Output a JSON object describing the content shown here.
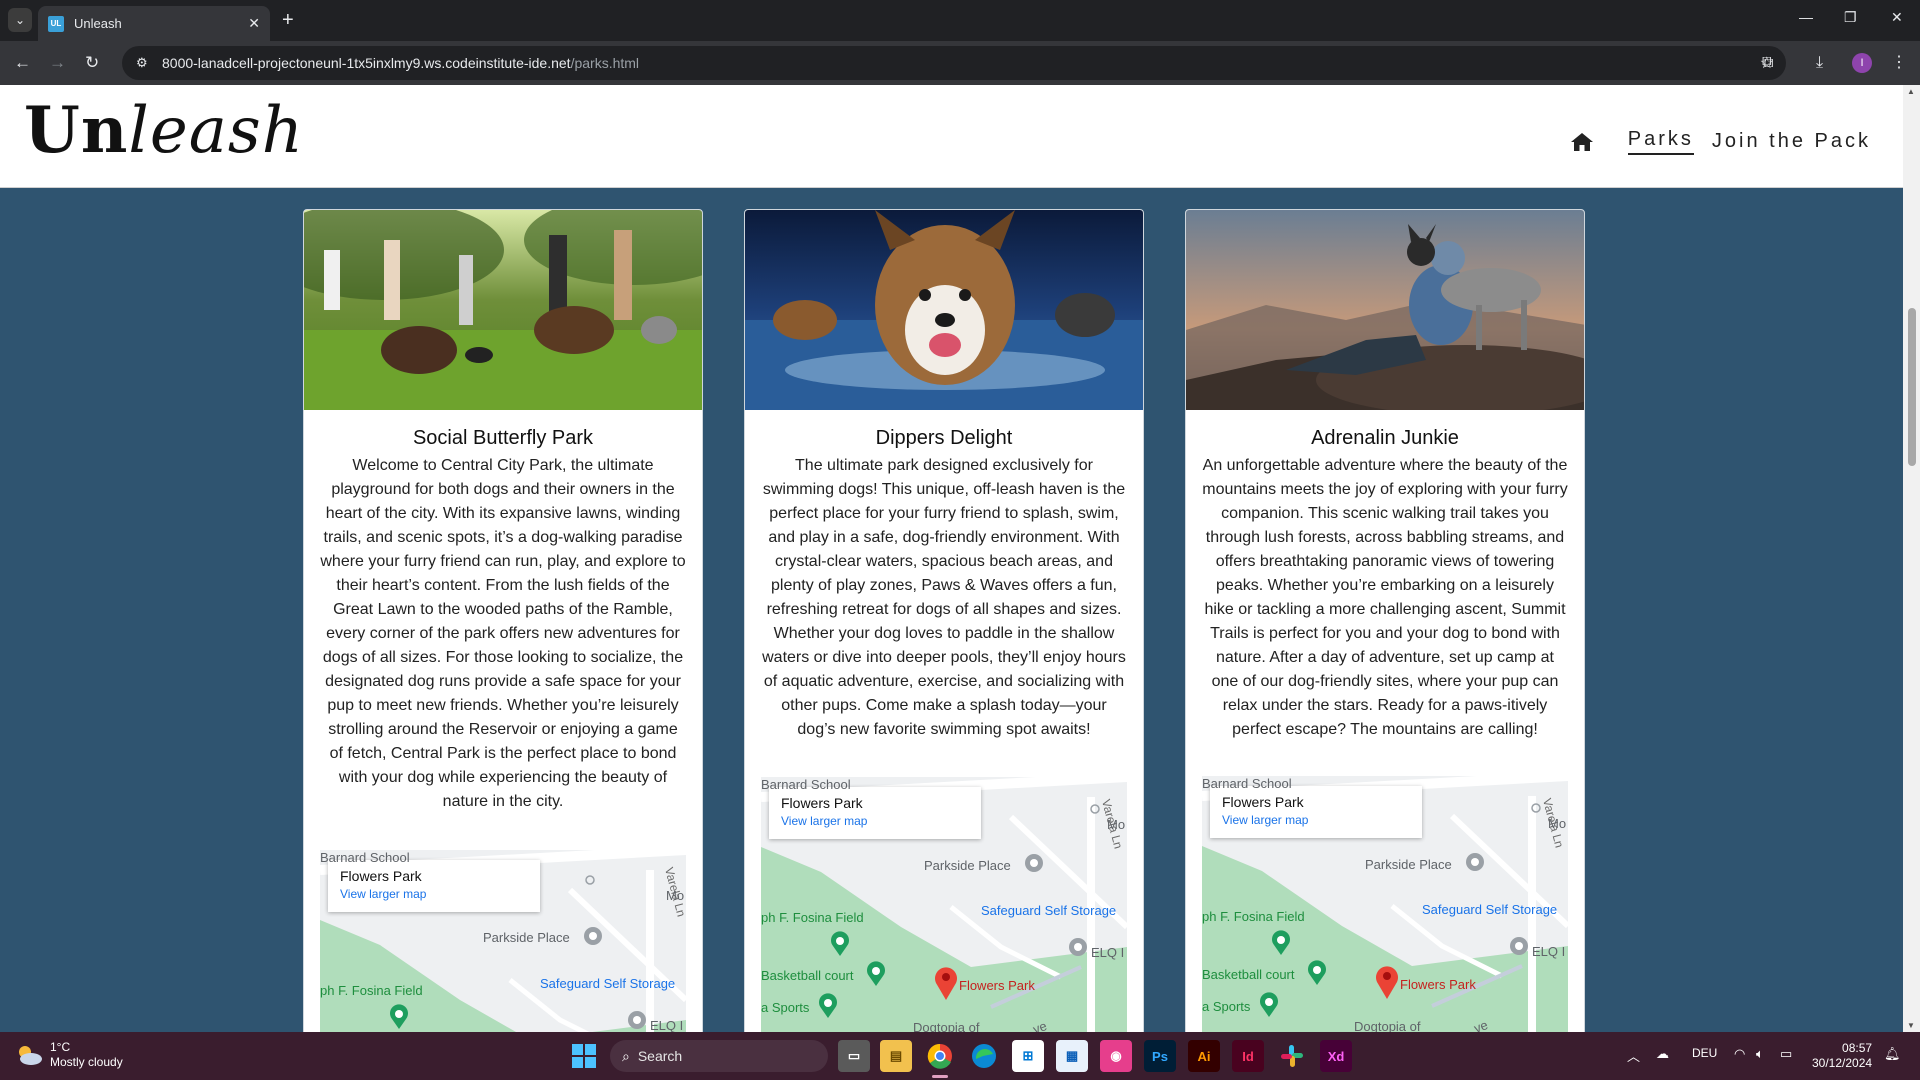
{
  "browser": {
    "tab_title": "Unleash",
    "tab_favicon": "UL",
    "url_host": "8000-lanadcell-projectoneunl-1tx5inxlmy9.ws.codeinstitute-ide.net",
    "url_path": "/parks.html",
    "profile_initial": "I"
  },
  "site": {
    "logo_upright": "Un",
    "logo_italic": "leash",
    "nav": {
      "parks": "Parks",
      "join": "Join the Pack"
    }
  },
  "cards": [
    {
      "title": "Social Butterfly Park",
      "text": "Welcome to Central City Park, the ultimate playground for both dogs and their owners in the heart of the city. With its expansive lawns, winding trails, and scenic spots, it’s a dog-walking paradise where your furry friend can run, play, and explore to their heart’s content. From the lush fields of the Great Lawn to the wooded paths of the Ramble, every corner of the park offers new adventures for dogs of all sizes. For those looking to socialize, the designated dog runs provide a safe space for your pup to meet new friends. Whether you’re leisurely strolling around the Reservoir or enjoying a game of fetch, Central Park is the perfect place to bond with your dog while experiencing the beauty of nature in the city."
    },
    {
      "title": "Dippers Delight",
      "text": "The ultimate park designed exclusively for swimming dogs! This unique, off-leash haven is the perfect place for your furry friend to splash, swim, and play in a safe, dog-friendly environment. With crystal-clear waters, spacious beach areas, and plenty of play zones, Paws & Waves offers a fun, refreshing retreat for dogs of all shapes and sizes. Whether your dog loves to paddle in the shallow waters or dive into deeper pools, they’ll enjoy hours of aquatic adventure, exercise, and socializing with other pups. Come make a splash today—your dog’s new favorite swimming spot awaits!"
    },
    {
      "title": "Adrenalin Junkie",
      "text": "An unforgettable adventure where the beauty of the mountains meets the joy of exploring with your furry companion. This scenic walking trail takes you through lush forests, across babbling streams, and offers breathtaking panoramic views of towering peaks. Whether you’re embarking on a leisurely hike or tackling a more challenging ascent, Summit Trails is perfect for you and your dog to bond with nature. After a day of adventure, set up camp at one of our dog-friendly sites, where your pup can relax under the stars. Ready for a paws-itively perfect escape? The mountains are calling!"
    }
  ],
  "map": {
    "place_name": "Flowers Park",
    "link": "View larger map",
    "labels": {
      "school": "Barnard School",
      "parkside": "Parkside Place",
      "fosina": "ph F. Fosina Field",
      "storage": "Safeguard Self Storage",
      "street": "Varela Ln",
      "mo": "Mo",
      "elq": "ELQ I",
      "basketball": "Basketball court",
      "sports": "a Sports",
      "dogtopia": "Dogtopia of",
      "ave": "ve",
      "flowers": "Flowers Park"
    }
  },
  "taskbar": {
    "temp": "1°C",
    "weather": "Mostly cloudy",
    "search": "Search",
    "lang": "DEU",
    "time": "08:57",
    "date": "30/12/2024"
  },
  "colors": {
    "page_bg": "#2f5470",
    "map_green": "#a8dab5",
    "marker_green": "#1e9e5e",
    "marker_red": "#ea4335",
    "link_blue": "#1a73e8"
  }
}
